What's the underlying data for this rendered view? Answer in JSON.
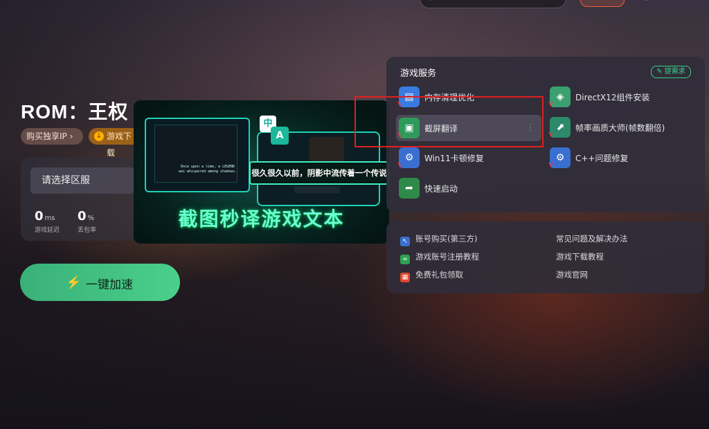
{
  "game": {
    "title": "ROM：王权",
    "tags": {
      "buy_ip": "购买独享IP ›",
      "download": "游戏下载"
    },
    "region_placeholder": "请选择区服",
    "latency": {
      "value": "0",
      "unit": "ms",
      "label": "游戏延迟"
    },
    "packet_loss": {
      "value": "0",
      "unit": "%",
      "label": "丢包率"
    },
    "accelerate_label": "一键加速"
  },
  "promo": {
    "headline": "截图秒译游戏文本",
    "subtitle": "很久很久以前，阴影中流传着一个传说",
    "source_text": "Once upon a time, a LEGEND was whispered among shadows.",
    "badge_zh": "中",
    "badge_a": "A"
  },
  "services": {
    "title": "游戏服务",
    "request_label": "提需求",
    "items": [
      {
        "label": "内存清理优化",
        "icon": "memory-cleanup-icon",
        "color": "#3a7be0"
      },
      {
        "label": "DirectX12组件安装",
        "icon": "directx-install-icon",
        "color": "#3aa070"
      },
      {
        "label": "截屏翻译",
        "icon": "screenshot-translate-icon",
        "color": "#2f9a5a"
      },
      {
        "label": "帧率画质大师(帧数翻倍)",
        "icon": "framerate-master-icon",
        "color": "#2a8a6a"
      },
      {
        "label": "Win11卡顿修复",
        "icon": "win11-fix-icon",
        "color": "#3a6fd0"
      },
      {
        "label": "C++问题修复",
        "icon": "cpp-fix-icon",
        "color": "#3a6fd0"
      },
      {
        "label": "快速启动",
        "icon": "quick-launch-icon",
        "color": "#2f8a4a"
      }
    ]
  },
  "links": {
    "left": [
      {
        "label": "账号购买(第三方)",
        "icon": "cart-icon",
        "color": "#3a6fd0"
      },
      {
        "label": "游戏账号注册教程",
        "icon": "link-icon",
        "color": "#2fa050"
      },
      {
        "label": "免费礼包领取",
        "icon": "gift-icon",
        "color": "#e04a30"
      }
    ],
    "right": [
      "常见问题及解决办法",
      "游戏下载教程",
      "游戏官网"
    ]
  }
}
